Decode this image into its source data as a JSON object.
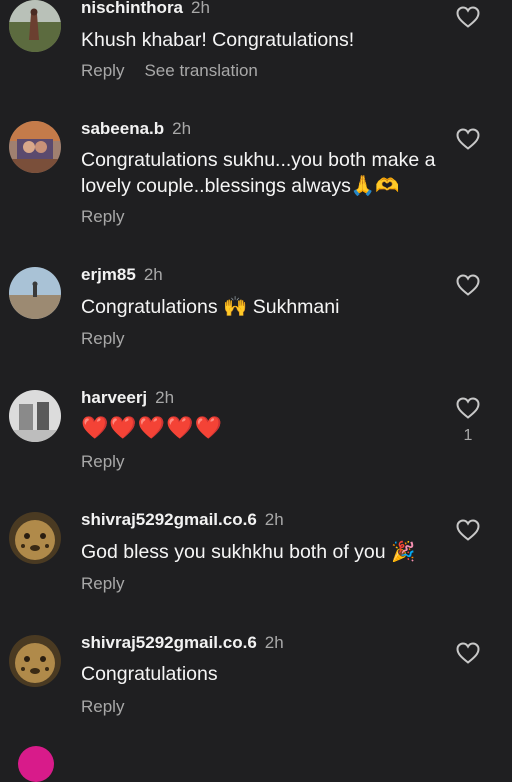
{
  "comments": [
    {
      "username": "nischinthora",
      "time": "2h",
      "text": "Khush khabar! Congratulations!",
      "reply": "Reply",
      "translate": "See translation"
    },
    {
      "username": "sabeena.b",
      "time": "2h",
      "text": "Congratulations sukhu...you both make a lovely couple..blessings always",
      "emoji": "🙏🫶",
      "reply": "Reply"
    },
    {
      "username": "erjm85",
      "time": "2h",
      "text_before": "Congratulations",
      "emoji": "🙌",
      "text_after": "Sukhmani",
      "reply": "Reply"
    },
    {
      "username": "harveerj",
      "time": "2h",
      "text": "❤️❤️❤️❤️❤️",
      "reply": "Reply",
      "likes": "1"
    },
    {
      "username": "shivraj5292gmail.co.6",
      "time": "2h",
      "text": "God bless you sukhkhu both of you",
      "emoji": "🎉",
      "reply": "Reply"
    },
    {
      "username": "shivraj5292gmail.co.6",
      "time": "2h",
      "text": "Congratulations",
      "reply": "Reply"
    }
  ],
  "icons": {
    "like": "heart-outline-icon"
  },
  "colors": {
    "background": "#1f1f21",
    "muted": "#a8a8a8",
    "text": "#f5f5f5"
  }
}
